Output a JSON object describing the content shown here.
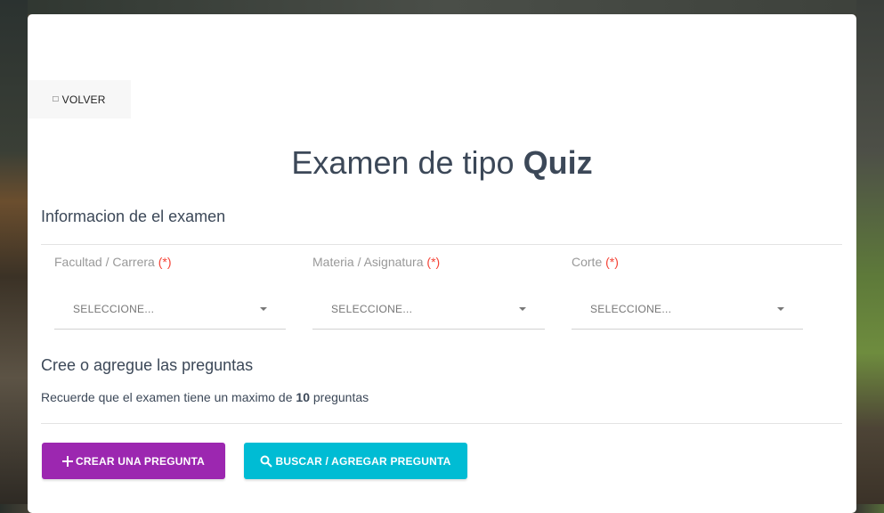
{
  "back_button": {
    "label": "VOLVER",
    "icon": "arrow-left-icon"
  },
  "title": {
    "prefix": "Examen de tipo ",
    "bold": "Quiz"
  },
  "section_info": {
    "title": "Informacion de el examen"
  },
  "fields": [
    {
      "label": "Facultad / Carrera",
      "required_mark": "(*)",
      "value": "SELECCIONE..."
    },
    {
      "label": "Materia / Asignatura",
      "required_mark": "(*)",
      "value": "SELECCIONE..."
    },
    {
      "label": "Corte",
      "required_mark": "(*)",
      "value": "SELECCIONE..."
    }
  ],
  "section_questions": {
    "title": "Cree o agregue las preguntas",
    "note_prefix": "Recuerde que el examen tiene un maximo de ",
    "note_count": "10",
    "note_suffix": " preguntas"
  },
  "buttons": {
    "create": {
      "label": "CREAR UNA PREGUNTA",
      "icon": "plus-icon"
    },
    "search": {
      "label": "BUSCAR / AGREGAR PREGUNTA",
      "icon": "search-icon"
    }
  },
  "colors": {
    "create": "#9c27b0",
    "search": "#00bcd4",
    "required": "#f44336"
  }
}
